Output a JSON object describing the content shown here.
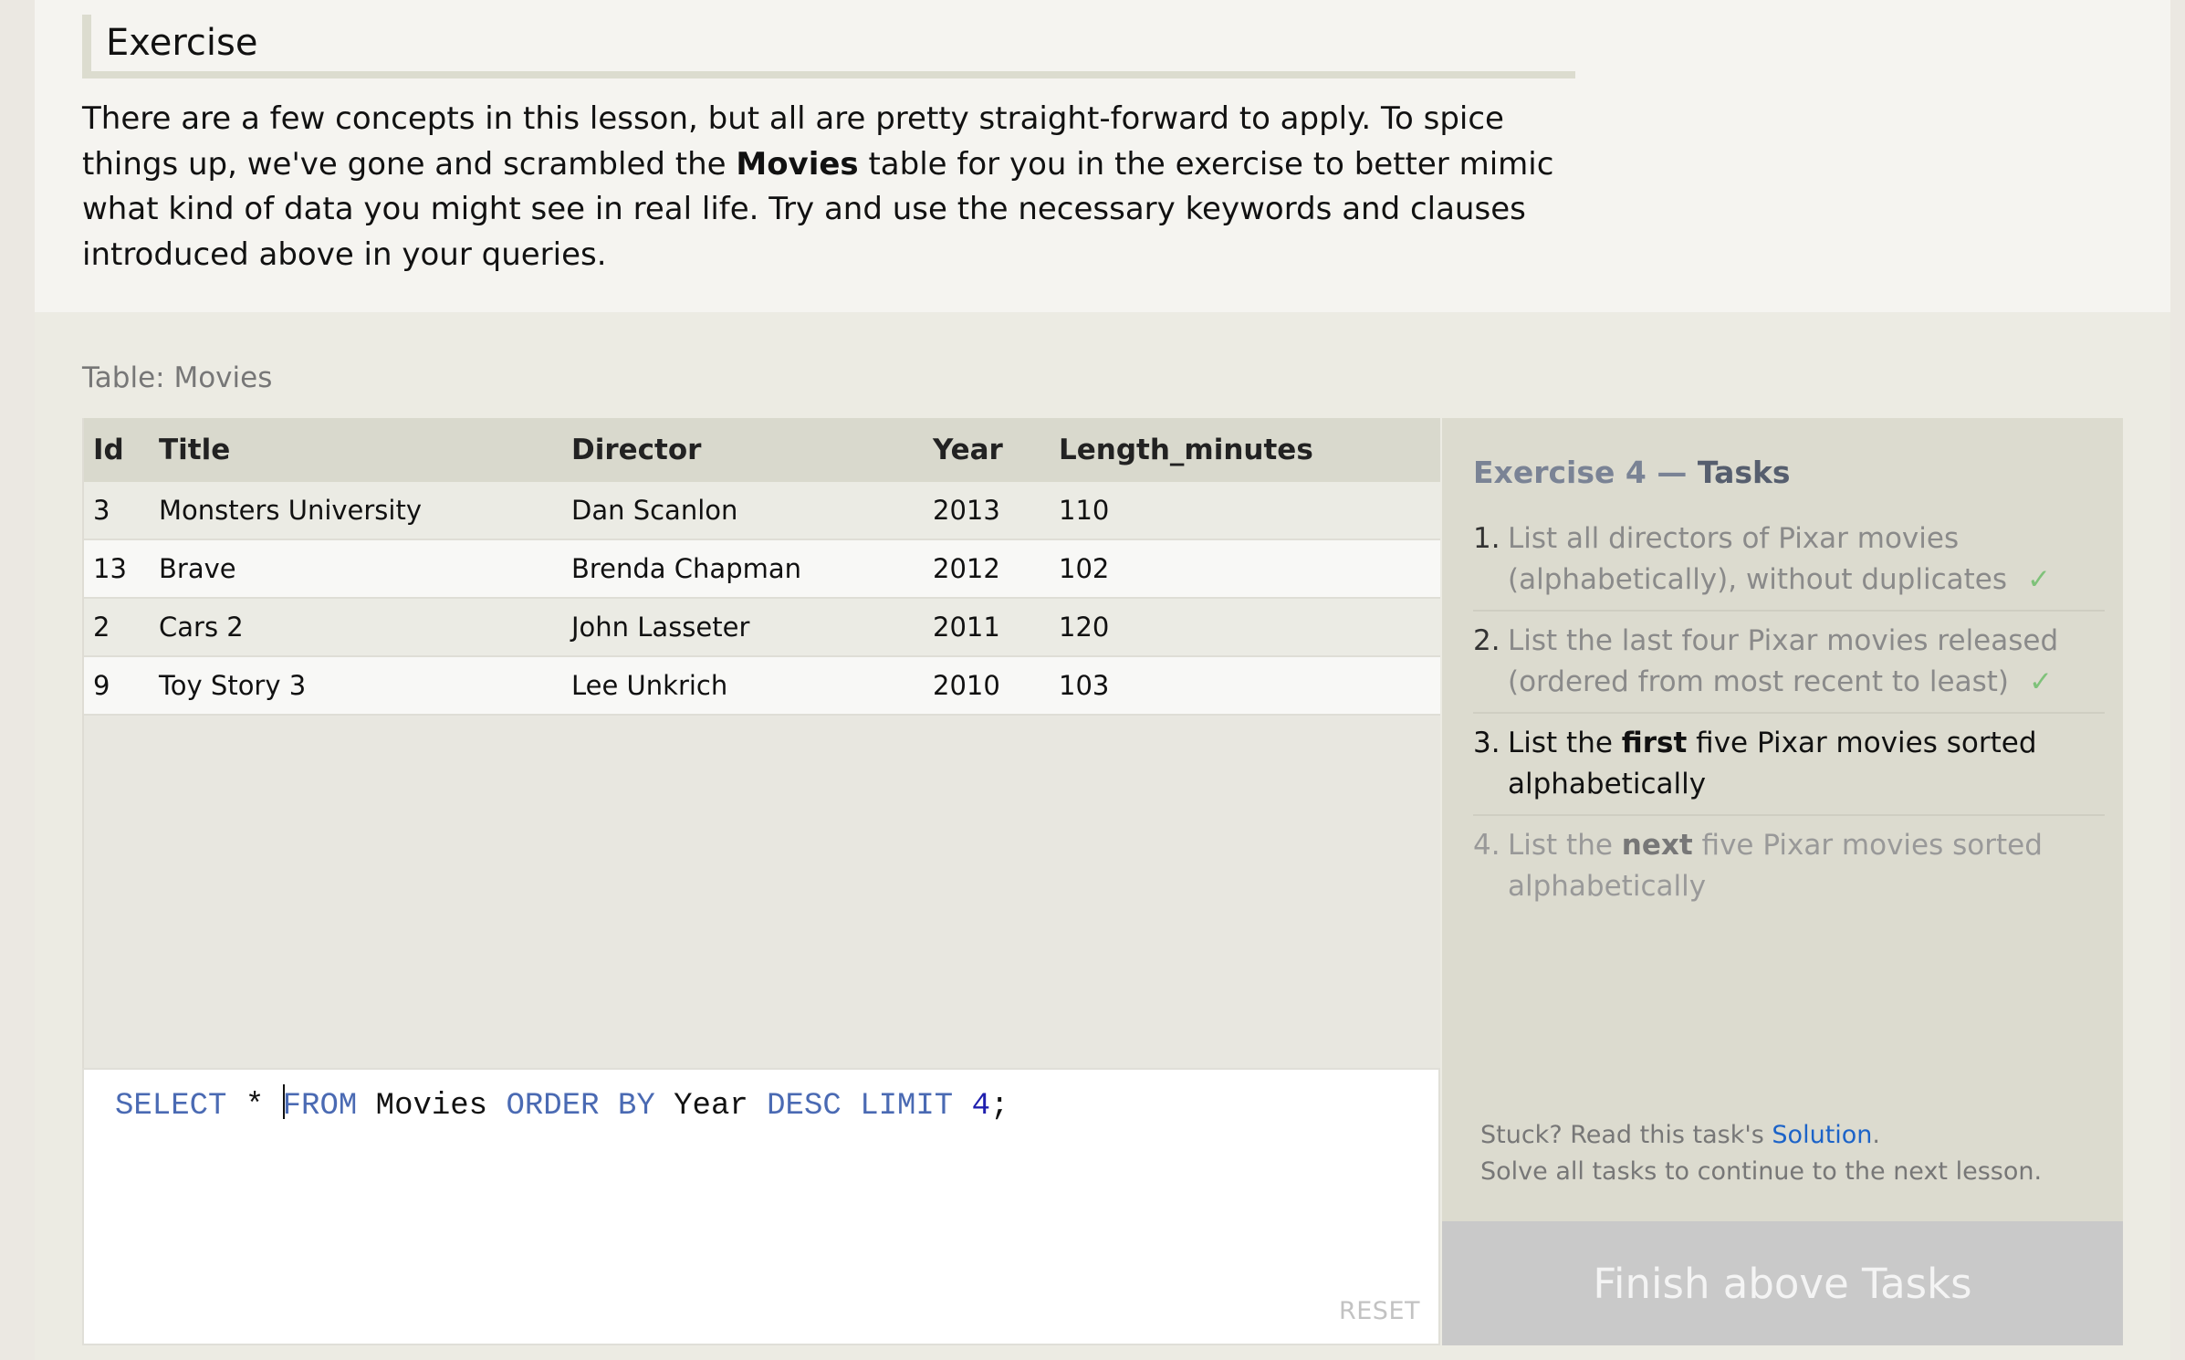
{
  "intro": {
    "heading": "Exercise",
    "text_part1": "There are a few concepts in this lesson, but all are pretty straight-forward to apply. To spice things up, we've gone and scrambled the ",
    "text_bold": "Movies",
    "text_part2": " table for you in the exercise to better mimic what kind of data you might see in real life. Try and use the necessary keywords and clauses introduced above in your queries."
  },
  "table": {
    "caption": "Table: Movies",
    "columns": [
      "Id",
      "Title",
      "Director",
      "Year",
      "Length_minutes"
    ],
    "rows": [
      [
        "3",
        "Monsters University",
        "Dan Scanlon",
        "2013",
        "110"
      ],
      [
        "13",
        "Brave",
        "Brenda Chapman",
        "2012",
        "102"
      ],
      [
        "2",
        "Cars 2",
        "John Lasseter",
        "2011",
        "120"
      ],
      [
        "9",
        "Toy Story 3",
        "Lee Unkrich",
        "2010",
        "103"
      ]
    ]
  },
  "editor": {
    "tokens": {
      "select": "SELECT",
      "star": " * ",
      "from": "FROM",
      "table": " Movies ",
      "order_by": "ORDER BY",
      "column": " Year ",
      "desc": "DESC",
      "space": " ",
      "limit": "LIMIT",
      "space2": " ",
      "number": "4",
      "semicolon": ";"
    },
    "reset_label": "RESET"
  },
  "tasks": {
    "title_prefix": "Exercise 4 — ",
    "title_accent": "Tasks",
    "items": [
      {
        "num": "1.",
        "text": "List all directors of Pixar movies (alphabetically), without duplicates",
        "status": "done",
        "check": "✓"
      },
      {
        "num": "2.",
        "text": "List the last four Pixar movies released (ordered from most recent to least)",
        "status": "done",
        "check": "✓"
      },
      {
        "num": "3.",
        "pre": "List the ",
        "bold": "first",
        "post": " five Pixar movies sorted alphabetically",
        "status": "current"
      },
      {
        "num": "4.",
        "pre": "List the ",
        "bold": "next",
        "post": " five Pixar movies sorted alphabetically",
        "status": "pending"
      }
    ],
    "help_prefix": "Stuck? Read this task's ",
    "help_link": "Solution",
    "help_suffix": ".",
    "help_line2": "Solve all tasks to continue to the next lesson.",
    "finish_label": "Finish above Tasks"
  },
  "colors": {
    "keyword": "#4a6ab3",
    "number": "#1f1fae",
    "check": "#7fc27a",
    "link": "#1c63c8",
    "finish_button_bg": "#c9c9c9"
  }
}
